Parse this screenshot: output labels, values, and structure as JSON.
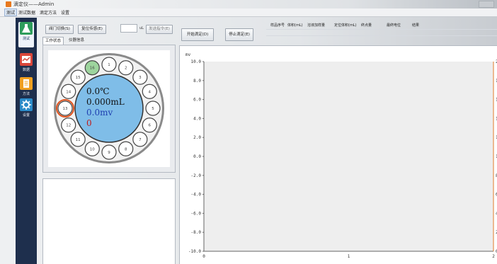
{
  "window": {
    "title": "滴定仪——Admin"
  },
  "menu": [
    "测试",
    "测试数据",
    "滴定方法",
    "设置"
  ],
  "sidebar": [
    {
      "label": "测试",
      "icon": "flask-icon",
      "color": "#2e9d5b"
    },
    {
      "label": "数据",
      "icon": "chart-icon",
      "color": "#d9463a"
    },
    {
      "label": "方法",
      "icon": "document-icon",
      "color": "#f0a020"
    },
    {
      "label": "设置",
      "icon": "gear-icon",
      "color": "#2b8bc9"
    }
  ],
  "toolbar": {
    "run_pump": "阀门切换(S)",
    "reset_pump": "复位传感(E)",
    "volume_input": "",
    "unit": "uL",
    "send_button": "发送指令(E)"
  },
  "controls": {
    "start": "开始滴定(D)",
    "stop": "停止滴定(E)"
  },
  "tabs": [
    "工作状态",
    "仪器信息"
  ],
  "carousel": {
    "active_position": "16",
    "temperature": "0.0℃",
    "volume": "0.000mL",
    "potential": "0.0mv",
    "status_code": "0",
    "positions": [
      "1",
      "2",
      "3",
      "4",
      "5",
      "6",
      "7",
      "8",
      "9",
      "10",
      "11",
      "12",
      "13",
      "14",
      "15",
      "16"
    ],
    "highlight_color": "#e0531e",
    "display_color": "#7fbde8"
  },
  "results_table": {
    "headers": [
      "样品序号",
      "体积(mL)",
      "溶液加样量",
      "定位体积(mL)",
      "终点量",
      "最终电位",
      "结果"
    ]
  },
  "chart_data": {
    "type": "line",
    "ylabel": "mv",
    "ylim": [
      -10.0,
      10.0
    ],
    "y_ticks": [
      "10.0",
      "8.0",
      "6.0",
      "4.0",
      "2.0",
      "0.0",
      "-2.0",
      "-4.0",
      "-6.0",
      "-8.0",
      "-10.0"
    ],
    "x_ticks": [
      "0",
      "1",
      "2"
    ],
    "xlim": [
      0,
      2
    ],
    "right_ticks": [
      "2",
      "1",
      "1",
      "1",
      "1",
      "1",
      "8",
      "6",
      "4",
      "2",
      "0"
    ],
    "series": []
  }
}
